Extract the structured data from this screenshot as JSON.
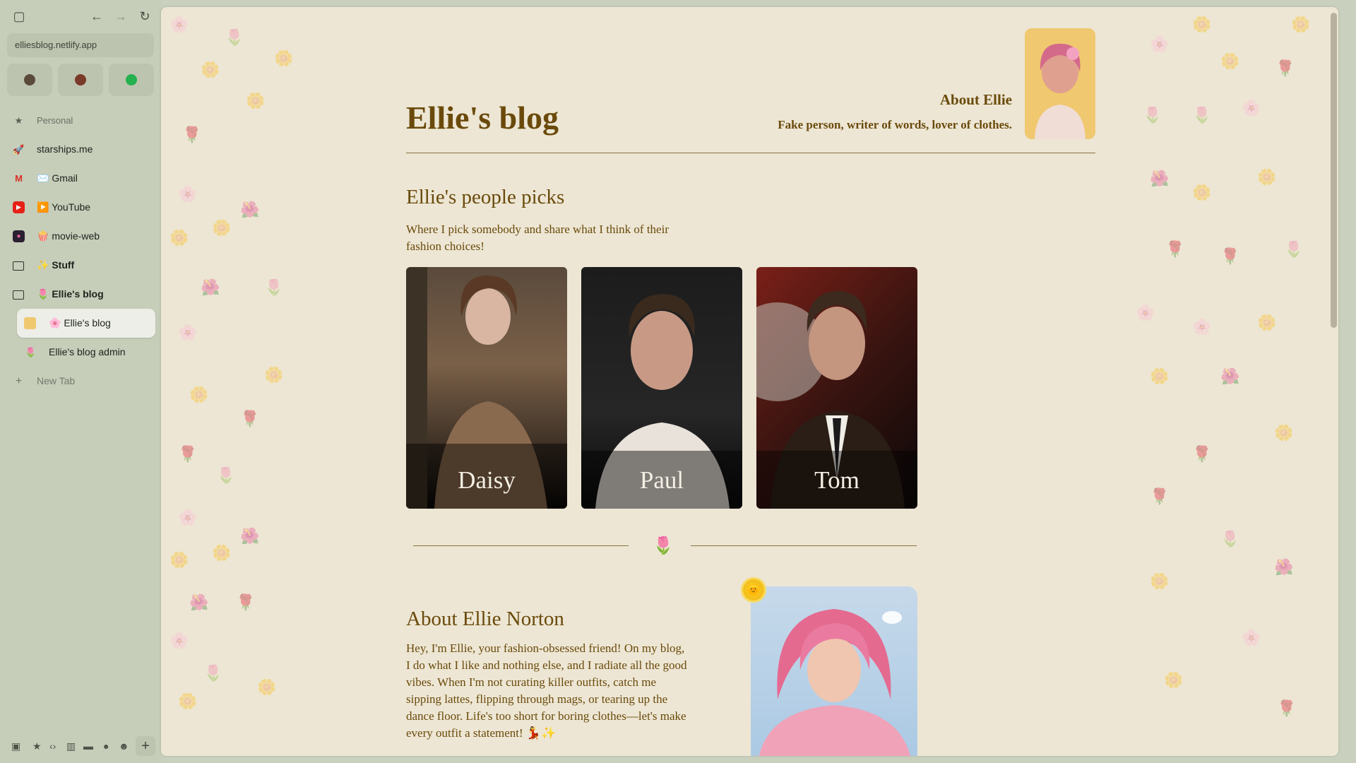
{
  "browser": {
    "url": "elliesblog.netlify.app"
  },
  "sidebar": {
    "section_label": "Personal",
    "items": [
      {
        "label": "starships.me"
      },
      {
        "label": "✉️ Gmail"
      },
      {
        "label": "▶️ YouTube"
      },
      {
        "label": "🍿 movie-web"
      },
      {
        "label": "✨ Stuff"
      },
      {
        "label": "🌷 Ellie's blog"
      },
      {
        "label": "🌸 Ellie's blog"
      },
      {
        "label": "Ellie's blog admin"
      }
    ],
    "new_tab_label": "New Tab"
  },
  "page": {
    "blog_title": "Ellie's blog",
    "about": {
      "heading": "About Ellie",
      "tagline": "Fake person, writer of words, lover of clothes."
    },
    "picks": {
      "title": "Ellie's people picks",
      "description": "Where I pick somebody and share what I think of their fashion choices!",
      "cards": [
        {
          "name": "Daisy"
        },
        {
          "name": "Paul"
        },
        {
          "name": "Tom"
        }
      ]
    },
    "about_section": {
      "title": "About Ellie Norton",
      "body": "Hey, I'm Ellie, your fashion-obsessed friend! On my blog, I do what I like and nothing else, and I radiate all the good vibes. When I'm not curating killer outfits, catch me sipping lattes, flipping through mags, or tearing up the dance floor. Life's too short for boring clothes—let's make every outfit a statement! 💃✨"
    }
  },
  "colors": {
    "page_bg": "#ede6d4",
    "accent_text": "#6a4a0b",
    "sidebar_bg": "#c6cdb9"
  }
}
